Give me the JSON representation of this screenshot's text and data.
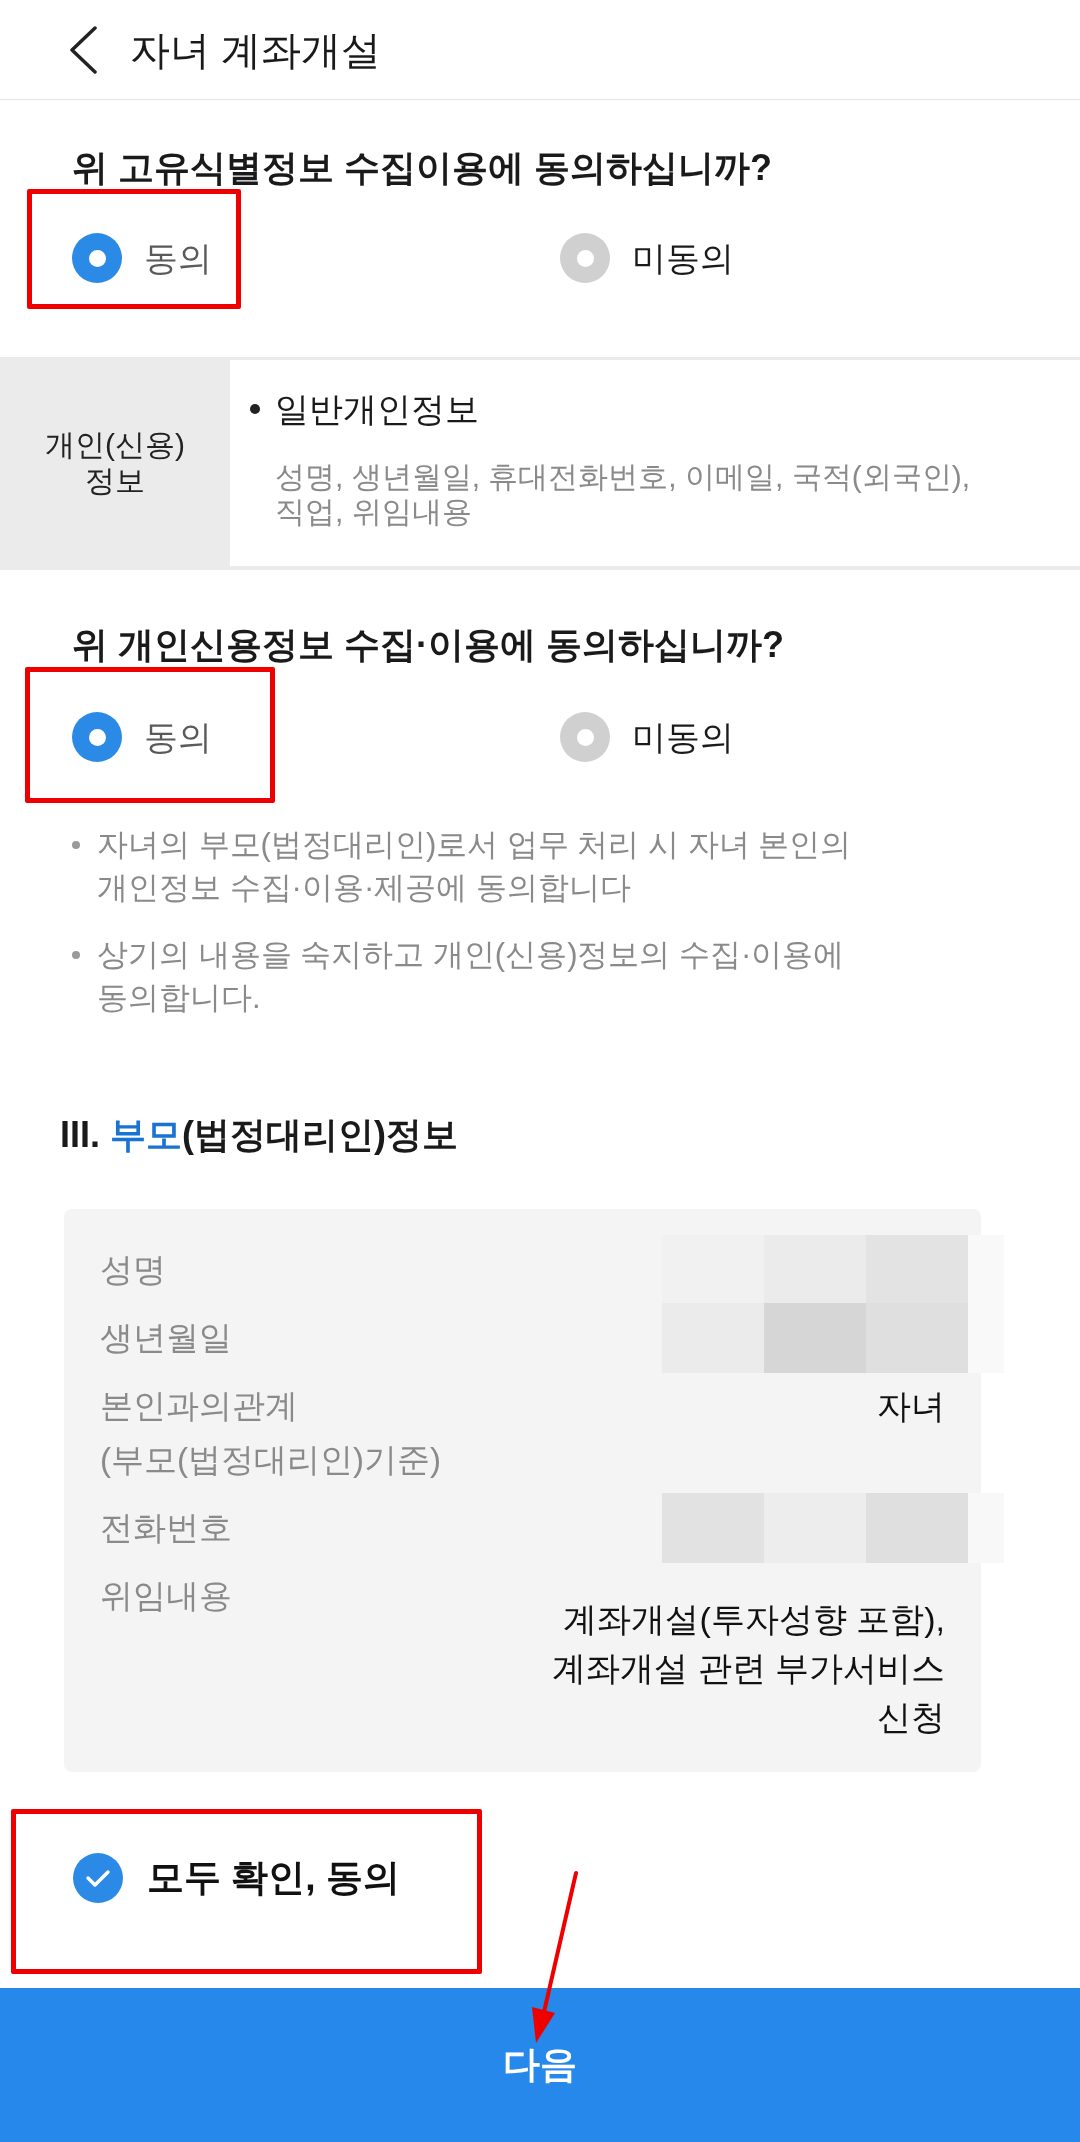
{
  "header": {
    "title": "자녀 계좌개설"
  },
  "unique_id_consent": {
    "question": "위 고유식별정보 수집이용에 동의하십니까?",
    "options": [
      {
        "label": "동의",
        "selected": true
      },
      {
        "label": "미동의",
        "selected": false
      }
    ]
  },
  "info_table": {
    "category": "개인(신용) 정보",
    "items": [
      {
        "title": "일반개인정보",
        "detail": "성명, 생년월일, 휴대전화번호, 이메일, 국적(외국인), 직업, 위임내용"
      }
    ]
  },
  "credit_consent": {
    "question": "위 개인신용정보 수집·이용에 동의하십니까?",
    "options": [
      {
        "label": "동의",
        "selected": true
      },
      {
        "label": "미동의",
        "selected": false
      }
    ],
    "notes": [
      "자녀의 부모(법정대리인)로서 업무 처리 시 자녀 본인의 개인정보 수집·이용·제공에 동의합니다",
      "상기의 내용을 숙지하고 개인(신용)정보의 수집·이용에 동의합니다."
    ]
  },
  "parent_info": {
    "numeral": "III.",
    "title_highlight": "부모",
    "title_rest": "(법정대리인)정보",
    "rows": [
      {
        "label": "성명",
        "redacted": true
      },
      {
        "label": "생년월일",
        "redacted": true
      },
      {
        "label": "본인과의관계\n(부모(법정대리인)기준)",
        "value": "자녀",
        "redacted": false
      },
      {
        "label": "전화번호",
        "redacted": true
      },
      {
        "label": "위임내용",
        "value": "계좌개설(투자성향 포함), 계좌개설 관련 부가서비스 신청",
        "redacted": false
      }
    ]
  },
  "agree_all": {
    "label": "모두 확인, 동의",
    "checked": true
  },
  "next_button": {
    "label": "다음"
  }
}
